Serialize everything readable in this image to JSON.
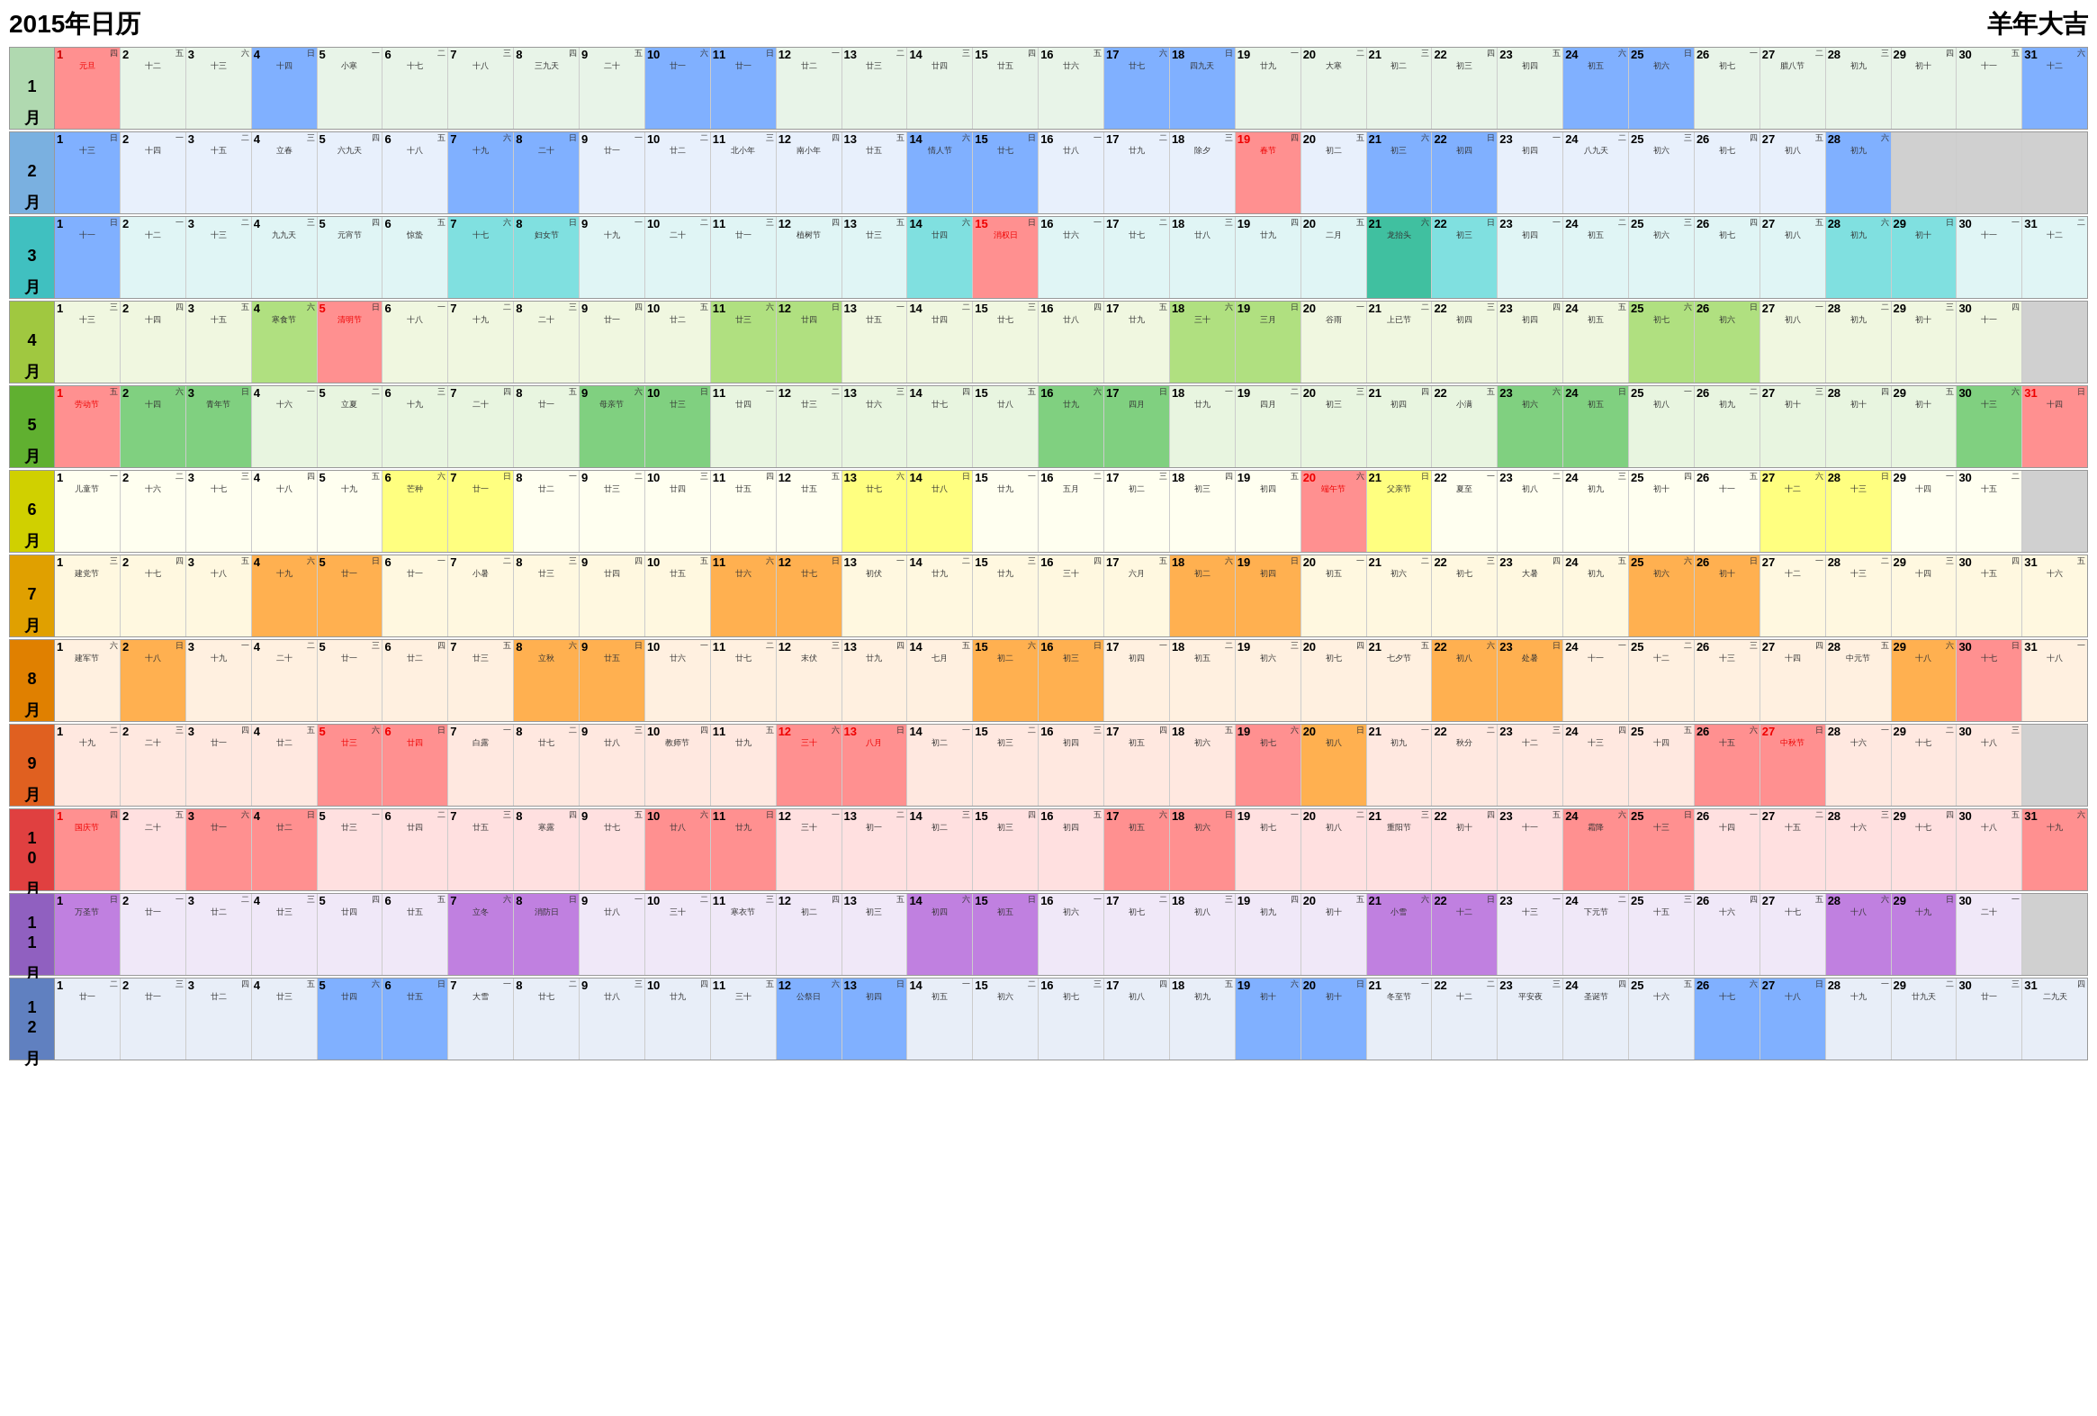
{
  "title": "2015年日历",
  "subtitle": "羊年大吉",
  "months": [
    {
      "label": "1月",
      "class": "month-jan"
    },
    {
      "label": "2月",
      "class": "month-feb"
    },
    {
      "label": "3月",
      "class": "month-mar"
    },
    {
      "label": "4月",
      "class": "month-apr"
    },
    {
      "label": "5月",
      "class": "month-may"
    },
    {
      "label": "6月",
      "class": "month-jun"
    },
    {
      "label": "7月",
      "class": "month-jul"
    },
    {
      "label": "8月",
      "class": "month-aug"
    },
    {
      "label": "9月",
      "class": "month-sep"
    },
    {
      "label": "10月",
      "class": "month-oct"
    },
    {
      "label": "11月",
      "class": "month-nov"
    },
    {
      "label": "12月",
      "class": "month-dec"
    }
  ]
}
